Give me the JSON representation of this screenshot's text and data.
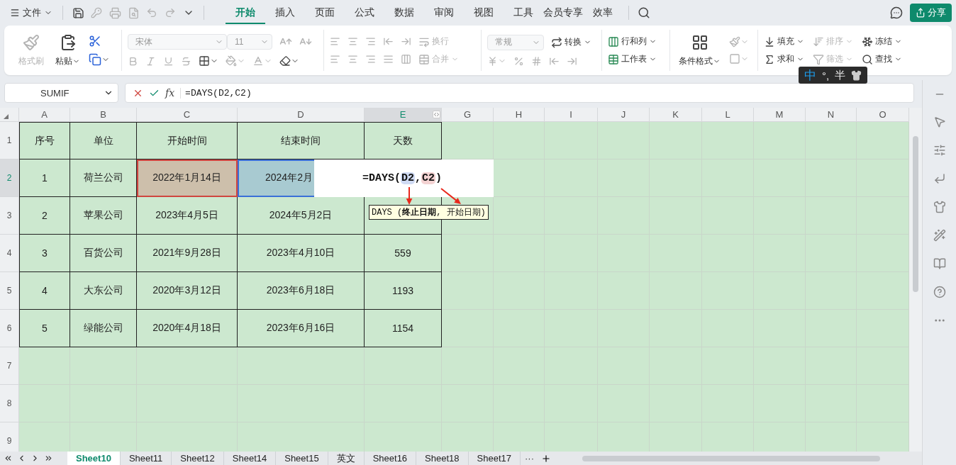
{
  "title_bar": {
    "file_menu": "文件",
    "tabs": [
      {
        "label": "开始",
        "selected": true
      },
      {
        "label": "插入",
        "selected": false
      },
      {
        "label": "页面",
        "selected": false
      },
      {
        "label": "公式",
        "selected": false
      },
      {
        "label": "数据",
        "selected": false
      },
      {
        "label": "审阅",
        "selected": false
      },
      {
        "label": "视图",
        "selected": false
      },
      {
        "label": "工具",
        "selected": false
      },
      {
        "label": "会员专享",
        "selected": false
      },
      {
        "label": "效率",
        "selected": false
      }
    ],
    "share_button": "分享"
  },
  "ribbon": {
    "format_painter": {
      "label": "格式刷",
      "disabled": true
    },
    "paste": {
      "label": "粘贴",
      "disabled": false
    },
    "font": {
      "value": "宋体",
      "disabled": true
    },
    "font_size": {
      "value": "11",
      "disabled": true
    },
    "wrap": {
      "label": "换行",
      "disabled": true
    },
    "merge": {
      "label": "合并",
      "disabled": true
    },
    "number_format": {
      "value": "常规",
      "disabled": true
    },
    "convert": {
      "label": "转换",
      "disabled": false
    },
    "rows_columns": {
      "label": "行和列",
      "disabled": false
    },
    "worksheet": {
      "label": "工作表",
      "disabled": false
    },
    "conditional_format": {
      "label": "条件格式",
      "disabled": false
    },
    "fill": {
      "label": "填充",
      "disabled": false
    },
    "sort": {
      "label": "排序",
      "disabled": true
    },
    "freeze": {
      "label": "冻结",
      "disabled": false
    },
    "sum": {
      "label": "求和",
      "disabled": false
    },
    "filter": {
      "label": "筛选",
      "disabled": true
    },
    "find": {
      "label": "查找",
      "disabled": false
    }
  },
  "ime_bar": {
    "mode": "中",
    "punctuation": "°,",
    "width": "半"
  },
  "formula_bar": {
    "name_box": "SUMIF",
    "function_label": "fx",
    "formula": "=DAYS(D2,C2)"
  },
  "sheet": {
    "columns": [
      {
        "label": "A",
        "selected": false
      },
      {
        "label": "B",
        "selected": false
      },
      {
        "label": "C",
        "selected": false
      },
      {
        "label": "D",
        "selected": false
      },
      {
        "label": "E",
        "selected": true
      },
      {
        "label": "G",
        "selected": false
      },
      {
        "label": "H",
        "selected": false
      },
      {
        "label": "I",
        "selected": false
      },
      {
        "label": "J",
        "selected": false
      },
      {
        "label": "K",
        "selected": false
      },
      {
        "label": "L",
        "selected": false
      },
      {
        "label": "M",
        "selected": false
      },
      {
        "label": "N",
        "selected": false
      },
      {
        "label": "O",
        "selected": false
      }
    ],
    "rows": [
      {
        "label": "1",
        "selected": false,
        "cells": [
          "序号",
          "单位",
          "开始时间",
          "结束时间",
          "天数"
        ]
      },
      {
        "label": "2",
        "selected": true,
        "cells": [
          "1",
          "荷兰公司",
          {
            "text": "2022年1月14日",
            "color": "#d0453f"
          },
          {
            "text": "2024年2月",
            "color": "#3a6fd8"
          },
          null
        ]
      },
      {
        "label": "3",
        "selected": false,
        "cells": [
          "2",
          "苹果公司",
          "2023年4月5日",
          "2024年5月2日",
          null
        ]
      },
      {
        "label": "4",
        "selected": false,
        "cells": [
          "3",
          "百货公司",
          "2021年9月28日",
          "2023年4月10日",
          "559"
        ]
      },
      {
        "label": "5",
        "selected": false,
        "cells": [
          "4",
          "大东公司",
          "2020年3月12日",
          "2023年6月18日",
          "1193"
        ]
      },
      {
        "label": "6",
        "selected": false,
        "cells": [
          "5",
          "绿能公司",
          "2020年4月18日",
          "2023年6月16日",
          "1154"
        ]
      },
      {
        "label": "7",
        "selected": false
      },
      {
        "label": "8",
        "selected": false
      },
      {
        "label": "9",
        "selected": false
      }
    ],
    "cell_editor": {
      "prefix": "=DAYS(",
      "arguments": [
        {
          "text": "D2",
          "color": "#cfdaf3"
        },
        {
          "text": "C2",
          "color": "#f3d2d2"
        }
      ],
      "separator": ",",
      "suffix": ")"
    },
    "tooltip": "DAYS (**终止日期**, 开始日期)"
  },
  "sheet_tabs": [
    {
      "label": "Sheet10",
      "selected": true
    },
    {
      "label": "Sheet11",
      "selected": false
    },
    {
      "label": "Sheet12",
      "selected": false
    },
    {
      "label": "Sheet14",
      "selected": false
    },
    {
      "label": "Sheet15",
      "selected": false
    },
    {
      "label": "英文",
      "selected": false
    },
    {
      "label": "Sheet16",
      "selected": false
    },
    {
      "label": "Sheet18",
      "selected": false
    },
    {
      "label": "Sheet17",
      "selected": false
    }
  ],
  "more_tabs": "···"
}
